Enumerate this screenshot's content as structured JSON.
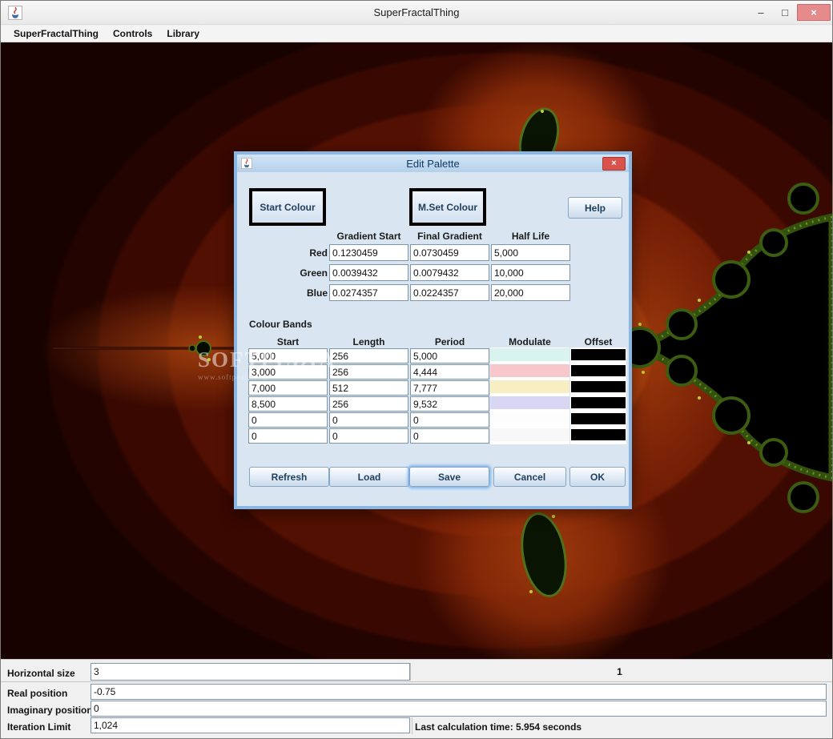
{
  "window": {
    "title": "SuperFractalThing",
    "menu_items": [
      "SuperFractalThing",
      "Controls",
      "Library"
    ],
    "controls": {
      "minimize": "–",
      "maximize": "□",
      "close": "×"
    }
  },
  "watermark": {
    "line1": "SOFTPEDIA",
    "line2": "www.softpedia.com"
  },
  "dialog": {
    "title": "Edit Palette",
    "close": "×",
    "start_colour_label": "Start Colour",
    "mset_colour_label": "M.Set Colour",
    "help_label": "Help",
    "gradient_headers": [
      "Gradient Start",
      "Final Gradient",
      "Half Life"
    ],
    "gradient_rows": [
      {
        "label": "Red",
        "gradient_start": "0.1230459",
        "final_gradient": "0.0730459",
        "half_life": "5,000"
      },
      {
        "label": "Green",
        "gradient_start": "0.0039432",
        "final_gradient": "0.0079432",
        "half_life": "10,000"
      },
      {
        "label": "Blue",
        "gradient_start": "0.0274357",
        "final_gradient": "0.0224357",
        "half_life": "20,000"
      }
    ],
    "colour_bands_label": "Colour Bands",
    "band_headers": [
      "Start",
      "Length",
      "Period",
      "Modulate",
      "Offset"
    ],
    "band_rows": [
      {
        "start": "5,000",
        "length": "256",
        "period": "5,000",
        "modulate": "#d9f3ee",
        "offset": "#000000"
      },
      {
        "start": "3,000",
        "length": "256",
        "period": "4,444",
        "modulate": "#f7c7cb",
        "offset": "#000000"
      },
      {
        "start": "7,000",
        "length": "512",
        "period": "7,777",
        "modulate": "#f7efc3",
        "offset": "#000000"
      },
      {
        "start": "8,500",
        "length": "256",
        "period": "9,532",
        "modulate": "#d9d6f4",
        "offset": "#000000"
      },
      {
        "start": "0",
        "length": "0",
        "period": "0",
        "modulate": "#fdfdfd",
        "offset": "#000000"
      },
      {
        "start": "0",
        "length": "0",
        "period": "0",
        "modulate": "#f8f8f8",
        "offset": "#000000"
      }
    ],
    "buttons": {
      "refresh": "Refresh",
      "load": "Load",
      "save": "Save",
      "cancel": "Cancel",
      "ok": "OK"
    }
  },
  "bottom_panel": {
    "horizontal_size_label": "Horizontal size",
    "horizontal_size_value": "3",
    "scale_value": "1",
    "real_position_label": "Real position",
    "real_position_value": "-0.75",
    "imaginary_position_label": "Imaginary position",
    "imaginary_position_value": "0",
    "iteration_limit_label": "Iteration Limit",
    "iteration_limit_value": "1,024",
    "last_calculation": "Last calculation time: 5.954 seconds"
  },
  "colors": {
    "dialog_bg": "#d9e6f2",
    "dialog_border": "#8ab6e4",
    "fractal_outer": "#180200",
    "fractal_bright": "#932f0a",
    "set_body": "#000000",
    "set_edge_green": "#3c5c10"
  }
}
